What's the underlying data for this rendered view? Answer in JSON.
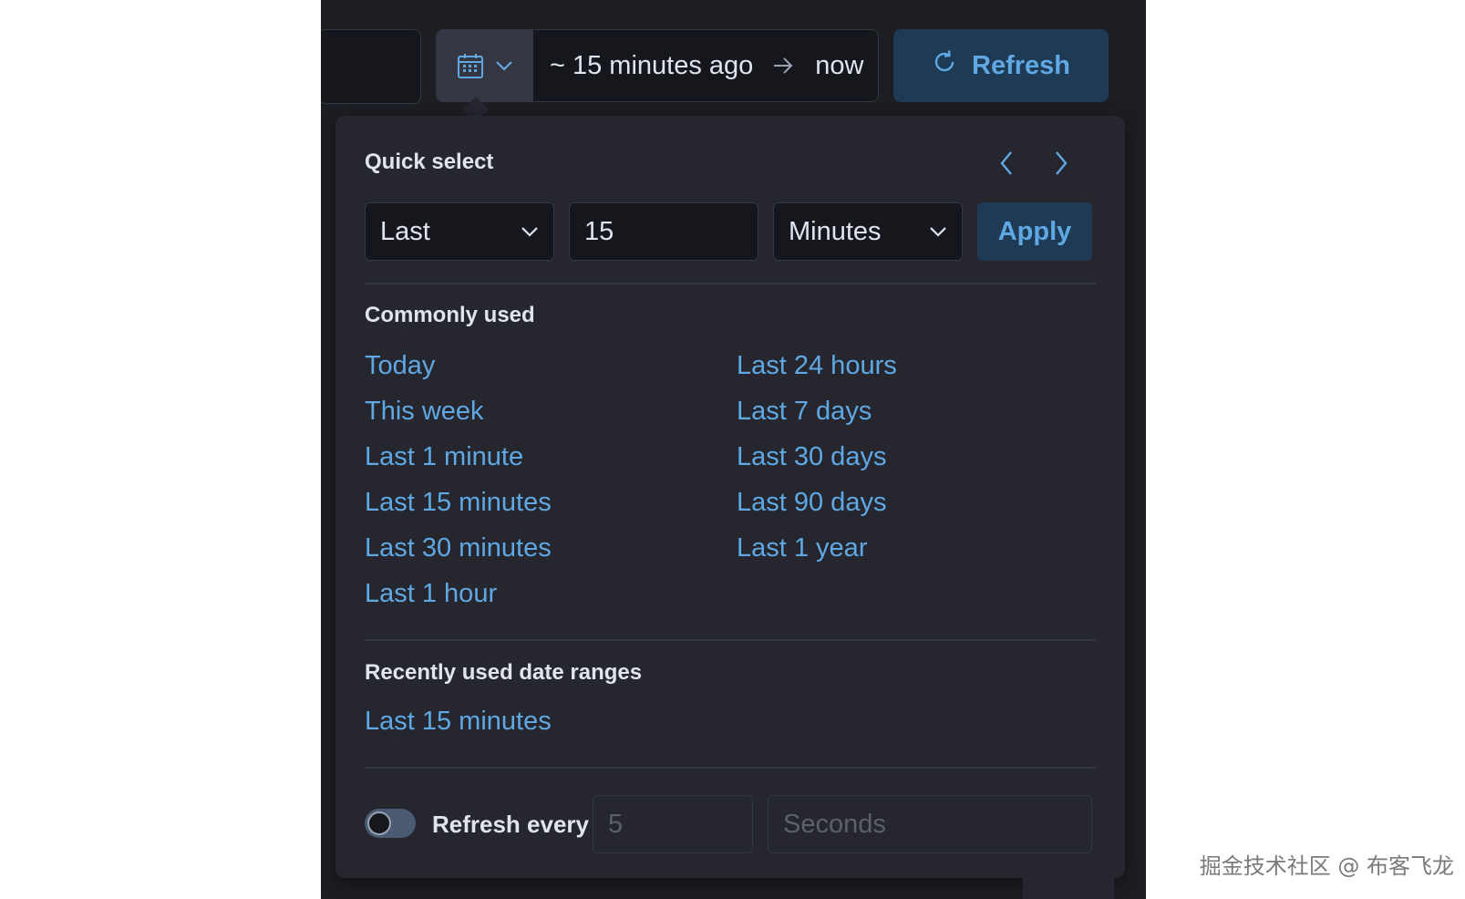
{
  "date_picker": {
    "start": "~ 15 minutes ago",
    "end": "now"
  },
  "refresh_button": {
    "label": "Refresh"
  },
  "quick_select": {
    "title": "Quick select",
    "direction": "Last",
    "value": "15",
    "unit": "Minutes",
    "apply_label": "Apply"
  },
  "commonly_used": {
    "title": "Commonly used",
    "left": [
      "Today",
      "This week",
      "Last 1 minute",
      "Last 15 minutes",
      "Last 30 minutes",
      "Last 1 hour"
    ],
    "right": [
      "Last 24 hours",
      "Last 7 days",
      "Last 30 days",
      "Last 90 days",
      "Last 1 year"
    ]
  },
  "recently_used": {
    "title": "Recently used date ranges",
    "items": [
      "Last 15 minutes"
    ]
  },
  "auto_refresh": {
    "label": "Refresh every",
    "interval_placeholder": "5",
    "unit_placeholder": "Seconds",
    "enabled": false
  },
  "watermark": "掘金技术社区 @ 布客飞龙",
  "colors": {
    "link": "#5fa8e4",
    "panel": "#25262e",
    "background": "#1d1e24",
    "button_bg": "#1f3a54"
  }
}
